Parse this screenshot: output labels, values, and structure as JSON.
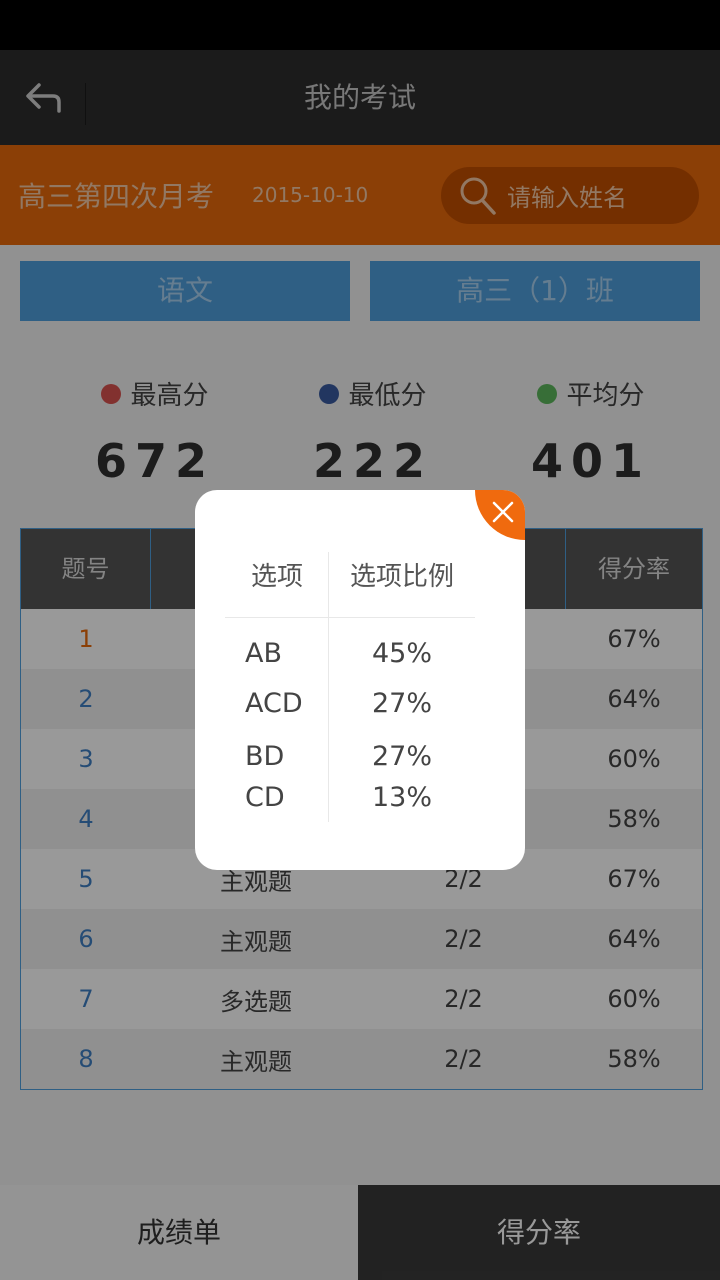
{
  "nav": {
    "title": "我的考试",
    "back_icon": "back-arrow-icon"
  },
  "exam": {
    "name": "高三第四次月考",
    "date": "2015-10-10",
    "search_placeholder": "请输入姓名"
  },
  "filters": {
    "subject": "语文",
    "class": "高三（1）班"
  },
  "stats": [
    {
      "label": "最高分",
      "value": "672",
      "color": "#d9534f"
    },
    {
      "label": "最低分",
      "value": "222",
      "color": "#3a5ba0"
    },
    {
      "label": "平均分",
      "value": "401",
      "color": "#5cb85c"
    }
  ],
  "table": {
    "headers": [
      "题号",
      "",
      "",
      "得分率"
    ],
    "rows": [
      {
        "num": "1",
        "type": "",
        "score": "",
        "rate": "67%"
      },
      {
        "num": "2",
        "type": "",
        "score": "",
        "rate": "64%"
      },
      {
        "num": "3",
        "type": "",
        "score": "",
        "rate": "60%"
      },
      {
        "num": "4",
        "type": "",
        "score": "",
        "rate": "58%"
      },
      {
        "num": "5",
        "type": "主观题",
        "score": "2/2",
        "rate": "67%"
      },
      {
        "num": "6",
        "type": "主观题",
        "score": "2/2",
        "rate": "64%"
      },
      {
        "num": "7",
        "type": "多选题",
        "score": "2/2",
        "rate": "60%"
      },
      {
        "num": "8",
        "type": "主观题",
        "score": "2/2",
        "rate": "58%"
      }
    ]
  },
  "popup": {
    "headers": [
      "选项",
      "选项比例"
    ],
    "rows": [
      {
        "option": "AB",
        "ratio": "45%"
      },
      {
        "option": "ACD",
        "ratio": "27%"
      },
      {
        "option": "BD",
        "ratio": "27%"
      },
      {
        "option": "CD",
        "ratio": "13%"
      }
    ]
  },
  "bottom_tabs": {
    "left": "成绩单",
    "right": "得分率"
  }
}
